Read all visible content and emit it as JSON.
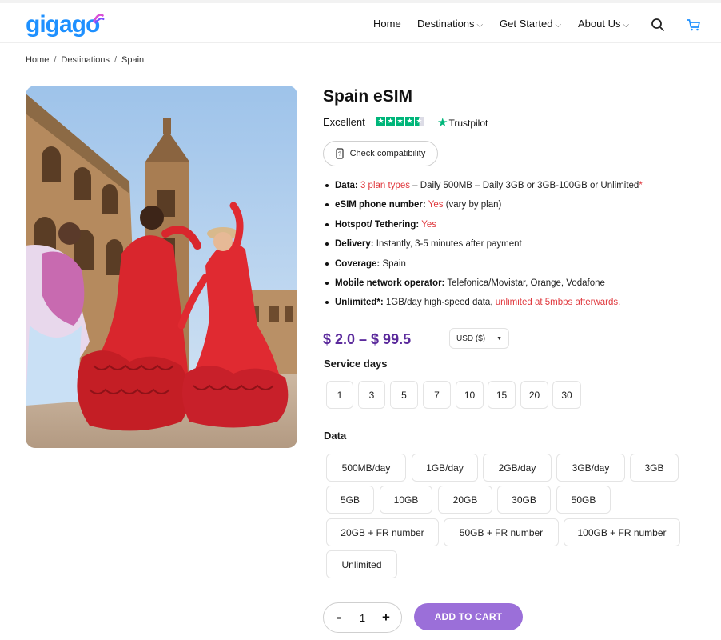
{
  "header": {
    "logo": "gigago",
    "nav": [
      {
        "label": "Home",
        "has_dropdown": false
      },
      {
        "label": "Destinations",
        "has_dropdown": true
      },
      {
        "label": "Get Started",
        "has_dropdown": true
      },
      {
        "label": "About Us",
        "has_dropdown": true
      }
    ],
    "icons": [
      "search-icon",
      "cart-icon"
    ]
  },
  "breadcrumb": [
    "Home",
    "Destinations",
    "Spain"
  ],
  "breadcrumb_sep": "/",
  "product": {
    "title": "Spain eSIM",
    "rating_label": "Excellent",
    "rating_stars": 4.5,
    "trustpilot": "Trustpilot",
    "check_compat": "Check compatibility",
    "features": [
      {
        "label": "Data:",
        "red": "3 plan types",
        "text": " – Daily 500MB – Daily 3GB or 3GB-100GB or Unlimited",
        "asterisk": "*"
      },
      {
        "label": "eSIM phone number:",
        "red": "Yes",
        "text": " (vary by plan)"
      },
      {
        "label": "Hotspot/ Tethering:",
        "red": "Yes",
        "text": ""
      },
      {
        "label": "Delivery:",
        "text": "Instantly, 3-5 minutes after payment"
      },
      {
        "label": "Coverage:",
        "text": "Spain"
      },
      {
        "label": "Mobile network operator:",
        "text": "Telefonica/Movistar, Orange, Vodafone"
      },
      {
        "label": "Unlimited*:",
        "text": "1GB/day high-speed data, ",
        "red": "unlimited at 5mbps afterwards."
      }
    ],
    "price": "$ 2.0 – $ 99.5",
    "currency": "USD ($)",
    "service_days_label": "Service days",
    "service_days": [
      "1",
      "3",
      "5",
      "7",
      "10",
      "15",
      "20",
      "30"
    ],
    "data_label": "Data",
    "data_options": [
      "500MB/day",
      "1GB/day",
      "2GB/day",
      "3GB/day",
      "3GB",
      "5GB",
      "10GB",
      "20GB",
      "30GB",
      "50GB",
      "20GB + FR number",
      "50GB + FR number",
      "100GB + FR number",
      "Unlimited"
    ],
    "quantity": "1",
    "qty_minus": "-",
    "qty_plus": "+",
    "add_to_cart": "ADD TO CART"
  },
  "colors": {
    "brand_blue": "#1e90ff",
    "price_purple": "#5b2a9c",
    "button_purple": "#9b6fd9",
    "accent_red": "#e0393e",
    "trustpilot_green": "#00b67a"
  }
}
